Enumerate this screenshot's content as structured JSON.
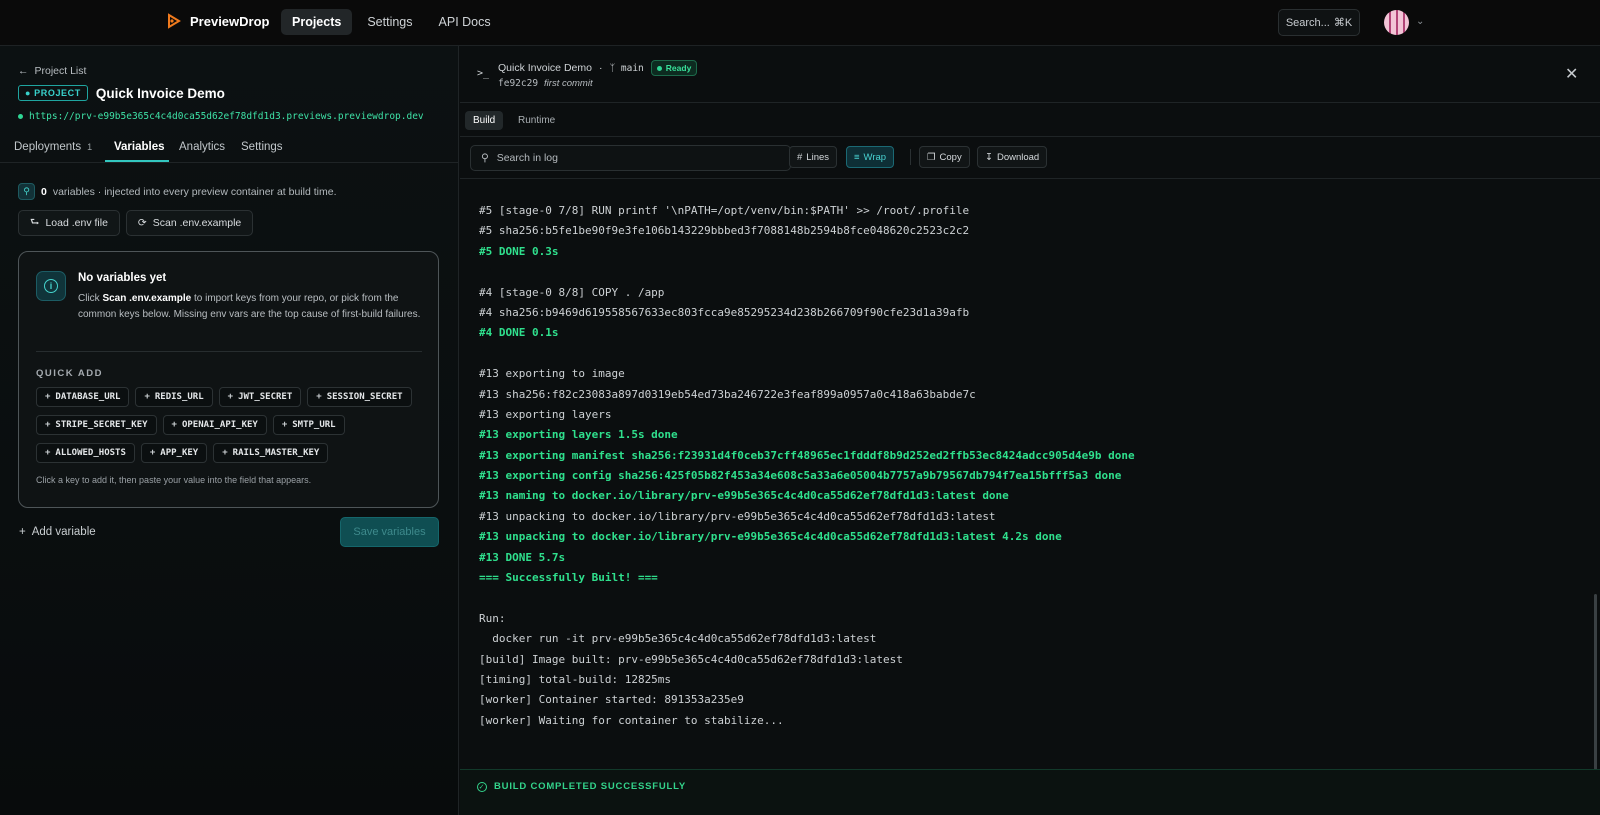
{
  "nav": {
    "brand": "PreviewDrop",
    "links": [
      {
        "label": "Projects",
        "active": true
      },
      {
        "label": "Settings",
        "active": false
      },
      {
        "label": "API Docs",
        "active": false
      }
    ],
    "search_label": "Search...",
    "search_shortcut": "⌘K"
  },
  "left": {
    "back_label": "Project List",
    "project_badge": "PROJECT",
    "project_title": "Quick Invoice Demo",
    "project_url": "https://prv-e99b5e365c4c4d0ca55d62ef78dfd1d3.previews.previewdrop.dev",
    "tabs": [
      {
        "label": "Deployments",
        "count": "1"
      },
      {
        "label": "Variables",
        "count": ""
      },
      {
        "label": "Analytics",
        "count": ""
      },
      {
        "label": "Settings",
        "count": ""
      }
    ],
    "var_count": "0",
    "var_info": "variables · injected into every preview container at build time.",
    "load_env_label": "Load .env file",
    "scan_env_label": "Scan .env.example",
    "empty": {
      "title": "No variables yet",
      "desc_pre": "Click",
      "desc_bold": "Scan .env.example",
      "desc_post": "to import keys from your repo, or pick from the common keys below. Missing env vars are the top cause of first-build failures.",
      "quick_add_label": "QUICK ADD",
      "chips": [
        "DATABASE_URL",
        "REDIS_URL",
        "JWT_SECRET",
        "SESSION_SECRET",
        "STRIPE_SECRET_KEY",
        "OPENAI_API_KEY",
        "SMTP_URL",
        "ALLOWED_HOSTS",
        "APP_KEY",
        "RAILS_MASTER_KEY"
      ],
      "footer": "Click a key to add it, then paste your value into the field that appears."
    },
    "add_variable_label": "Add variable",
    "save_label": "Save variables"
  },
  "right": {
    "title": "Quick Invoice Demo",
    "branch": "main",
    "status": "Ready",
    "commit_hash": "fe92c29",
    "commit_msg": "first commit",
    "subtabs": [
      "Build",
      "Runtime"
    ],
    "search_placeholder": "Search in log",
    "toolbar": {
      "lines": "Lines",
      "wrap": "Wrap",
      "copy": "Copy",
      "download": "Download"
    },
    "log": [
      {
        "t": "#5 [stage-0 7/8] RUN printf '\\nPATH=/opt/venv/bin:$PATH' >> /root/.profile",
        "g": false
      },
      {
        "t": "#5 sha256:b5fe1be90f9e3fe106b143229bbbed3f7088148b2594b8fce048620c2523c2c2",
        "g": false
      },
      {
        "t": "#5 DONE 0.3s",
        "g": true
      },
      {
        "t": "",
        "g": false
      },
      {
        "t": "#4 [stage-0 8/8] COPY . /app",
        "g": false
      },
      {
        "t": "#4 sha256:b9469d619558567633ec803fcca9e85295234d238b266709f90cfe23d1a39afb",
        "g": false
      },
      {
        "t": "#4 DONE 0.1s",
        "g": true
      },
      {
        "t": "",
        "g": false
      },
      {
        "t": "#13 exporting to image",
        "g": false
      },
      {
        "t": "#13 sha256:f82c23083a897d0319eb54ed73ba246722e3feaf899a0957a0c418a63babde7c",
        "g": false
      },
      {
        "t": "#13 exporting layers",
        "g": false
      },
      {
        "t": "#13 exporting layers 1.5s done",
        "g": true
      },
      {
        "t": "#13 exporting manifest sha256:f23931d4f0ceb37cff48965ec1fdddf8b9d252ed2ffb53ec8424adcc905d4e9b done",
        "g": true
      },
      {
        "t": "#13 exporting config sha256:425f05b82f453a34e608c5a33a6e05004b7757a9b79567db794f7ea15bfff5a3 done",
        "g": true
      },
      {
        "t": "#13 naming to docker.io/library/prv-e99b5e365c4c4d0ca55d62ef78dfd1d3:latest done",
        "g": true
      },
      {
        "t": "#13 unpacking to docker.io/library/prv-e99b5e365c4c4d0ca55d62ef78dfd1d3:latest",
        "g": false
      },
      {
        "t": "#13 unpacking to docker.io/library/prv-e99b5e365c4c4d0ca55d62ef78dfd1d3:latest 4.2s done",
        "g": true
      },
      {
        "t": "#13 DONE 5.7s",
        "g": true
      },
      {
        "t": "=== Successfully Built! ===",
        "g": true
      },
      {
        "t": "",
        "g": false
      },
      {
        "t": "Run:",
        "g": false
      },
      {
        "t": "  docker run -it prv-e99b5e365c4c4d0ca55d62ef78dfd1d3:latest",
        "g": false
      },
      {
        "t": "[build] Image built: prv-e99b5e365c4c4d0ca55d62ef78dfd1d3:latest",
        "g": false
      },
      {
        "t": "[timing] total-build: 12825ms",
        "g": false
      },
      {
        "t": "[worker] Container started: 891353a235e9",
        "g": false
      },
      {
        "t": "[worker] Waiting for container to stabilize...",
        "g": false
      }
    ],
    "status_bar": "BUILD COMPLETED SUCCESSFULLY"
  },
  "colors": {
    "accent": "#33c7c0",
    "success": "#2fe08d"
  }
}
